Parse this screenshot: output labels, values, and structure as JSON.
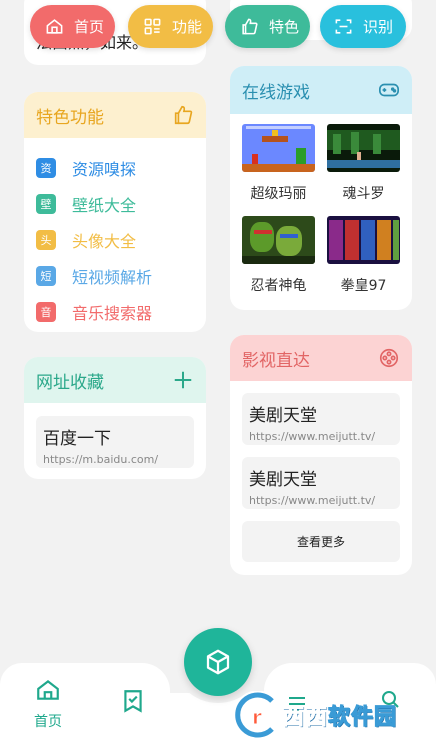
{
  "top_pills": [
    {
      "label": "首页",
      "icon": "home-icon",
      "color": "#f26b6b"
    },
    {
      "label": "功能",
      "icon": "grid-icon",
      "color": "#f2bd45"
    },
    {
      "label": "特色",
      "icon": "thumbs-up-icon",
      "color": "#3ebb9a"
    },
    {
      "label": "识别",
      "icon": "scan-icon",
      "color": "#29c0dd"
    }
  ],
  "top_card_text": "法由点，如来。",
  "features": {
    "title": "特色功能",
    "items": [
      {
        "badge": "资",
        "label": "资源嗅探",
        "color": "#2f8de4"
      },
      {
        "badge": "壁",
        "label": "壁纸大全",
        "color": "#3ebb9a"
      },
      {
        "badge": "头",
        "label": "头像大全",
        "color": "#f2bd45"
      },
      {
        "badge": "短",
        "label": "短视频解析",
        "color": "#5aa8e6"
      },
      {
        "badge": "音",
        "label": "音乐搜索器",
        "color": "#f26b6b"
      }
    ]
  },
  "favorites": {
    "title": "网址收藏",
    "sites": [
      {
        "name": "百度一下",
        "url": "https://m.baidu.com/"
      }
    ]
  },
  "games": {
    "title": "在线游戏",
    "items": [
      {
        "name": "超级玛丽"
      },
      {
        "name": "魂斗罗"
      },
      {
        "name": "忍者神龟"
      },
      {
        "name": "拳皇97"
      }
    ]
  },
  "movies": {
    "title": "影视直达",
    "sites": [
      {
        "name": "美剧天堂",
        "url": "https://www.meijutt.tv/"
      },
      {
        "name": "美剧天堂",
        "url": "https://www.meijutt.tv/"
      }
    ],
    "more_label": "查看更多"
  },
  "bottom_nav": {
    "home_label": "首页"
  },
  "watermark": {
    "brand_red": "西西",
    "brand_rest": "软件园"
  },
  "colors": {
    "accent": "#1fb59a",
    "background": "#f2f2f2"
  }
}
